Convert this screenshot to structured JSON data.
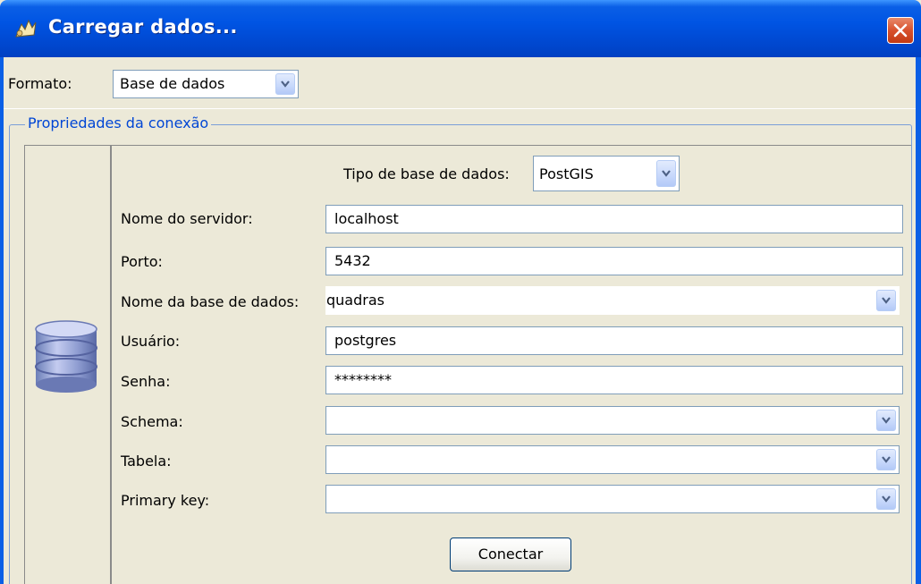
{
  "window": {
    "title": "Carregar dados...",
    "close_icon": "close-icon"
  },
  "format": {
    "label": "Formato:",
    "value": "Base de dados"
  },
  "group": {
    "title": "Propriedades da conexão",
    "icon": "database-icon"
  },
  "db_type": {
    "label": "Tipo de base de dados:",
    "value": "PostGIS"
  },
  "fields": {
    "server": {
      "label": "Nome do servidor:",
      "value": "localhost"
    },
    "port": {
      "label": "Porto:",
      "value": "5432"
    },
    "database": {
      "label": "Nome da base de dados:",
      "value": "quadras"
    },
    "user": {
      "label": "Usuário:",
      "value": "postgres"
    },
    "password": {
      "label": "Senha:",
      "value": "********"
    },
    "schema": {
      "label": "Schema:",
      "value": ""
    },
    "table": {
      "label": "Tabela:",
      "value": ""
    },
    "primary_key": {
      "label": "Primary key:",
      "value": ""
    }
  },
  "connect_button": {
    "label": "Conectar"
  },
  "colors": {
    "titlebar": "#0054e3",
    "group_title": "#0046d5",
    "close_button": "#d8512d",
    "window_bg": "#ece9d8"
  }
}
